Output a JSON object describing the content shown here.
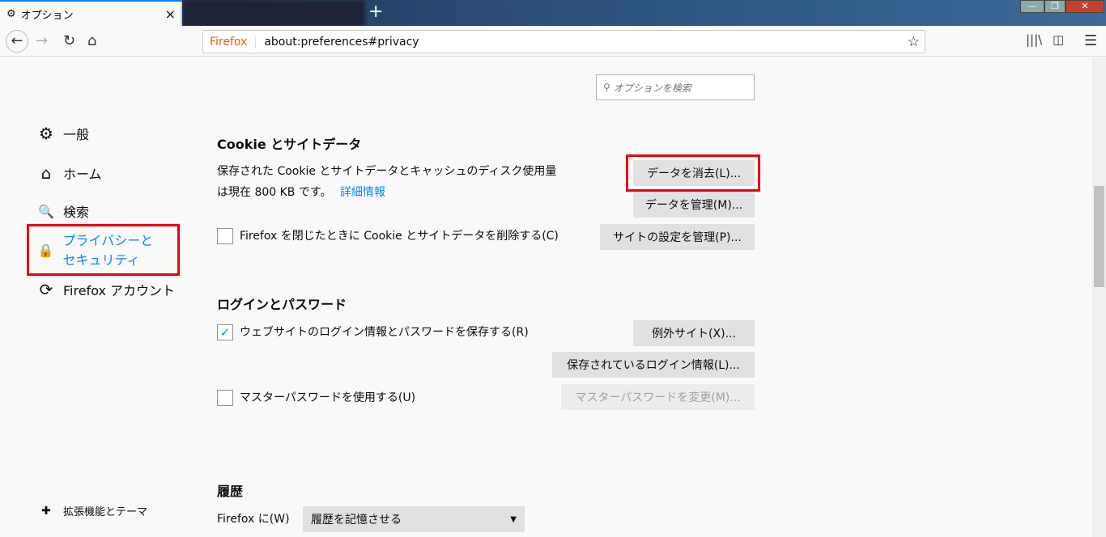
{
  "tab": {
    "title": "オプション",
    "close": "×",
    "new": "+"
  },
  "window": {
    "min": "—",
    "restore": "❐",
    "close": "✕"
  },
  "url": {
    "brand": "Firefox",
    "address": "about:preferences#privacy"
  },
  "search": {
    "placeholder": "オプションを検索"
  },
  "sidebar": {
    "items": [
      {
        "label": "一般",
        "icon": "⚙"
      },
      {
        "label": "ホーム",
        "icon": "⌂"
      },
      {
        "label": "検索",
        "icon": "🔍"
      },
      {
        "label": "プライバシーとセキュリティ",
        "icon": "🔒"
      },
      {
        "label": "Firefox アカウント",
        "icon": "⟳"
      }
    ],
    "extensions": "拡張機能とテーマ"
  },
  "cookies": {
    "heading": "Cookie とサイトデータ",
    "desc1": "保存された Cookie とサイトデータとキャッシュのディスク使用量",
    "desc2": "は現在 800 KB です。",
    "learn_more": "詳細情報",
    "clear": "データを消去(L)...",
    "manage": "データを管理(M)...",
    "delete_on_close": "Firefox を閉じたときに Cookie とサイトデータを削除する(C)",
    "site_settings": "サイトの設定を管理(P)..."
  },
  "logins": {
    "heading": "ログインとパスワード",
    "save": "ウェブサイトのログイン情報とパスワードを保存する(R)",
    "exceptions": "例外サイト(X)...",
    "saved": "保存されているログイン情報(L)...",
    "master": "マスターパスワードを使用する(U)",
    "change_master": "マスターパスワードを変更(M)..."
  },
  "history": {
    "heading": "履歴",
    "label": "Firefox に(W)",
    "select": "履歴を記憶させる"
  },
  "colors": {
    "accent": "#0a84ff",
    "highlight": "#e8000f"
  }
}
